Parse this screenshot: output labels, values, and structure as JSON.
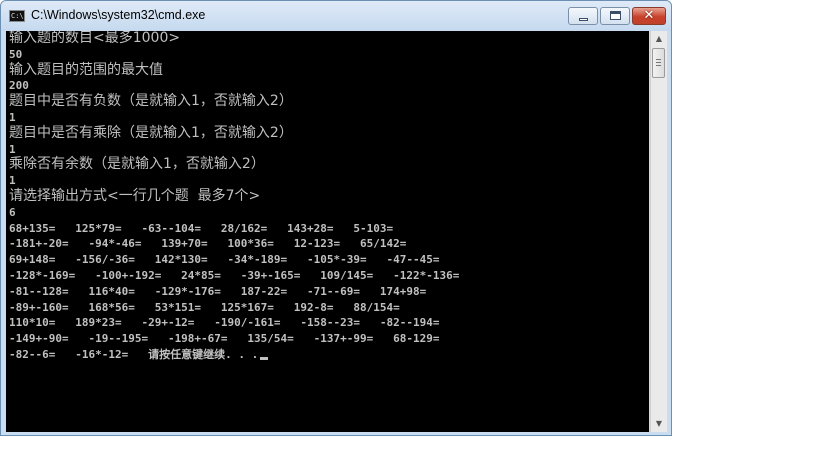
{
  "window": {
    "title": "C:\\Windows\\system32\\cmd.exe",
    "icon": "cmd-icon",
    "icon_label": "C:\\",
    "controls": {
      "minimize": "minimize-icon",
      "maximize": "maximize-icon",
      "close": "close-icon",
      "close_glyph": "✕"
    }
  },
  "colors": {
    "console_bg": "#000000",
    "console_text": "#c0c0c0",
    "close_button": "#c8412b"
  },
  "console": {
    "lines": [
      "输入题的数目<最多1000>",
      "50",
      "输入题目的范围的最大值",
      "200",
      "题目中是否有负数（是就输入1，否就输入2）",
      "1",
      "题目中是否有乘除（是就输入1，否就输入2）",
      "1",
      "乘除否有余数（是就输入1，否就输入2）",
      "1",
      "请选择输出方式<一行几个题  最多7个>",
      "6",
      "68+135=   125*79=   -63--104=   28/162=   143+28=   5-103=",
      "-181+-20=   -94*-46=   139+70=   100*36=   12-123=   65/142=",
      "69+148=   -156/-36=   142*130=   -34*-189=   -105*-39=   -47--45=",
      "-128*-169=   -100+-192=   24*85=   -39+-165=   109/145=   -122*-136=",
      "-81--128=   116*40=   -129*-176=   187-22=   -71--69=   174+98=",
      "-89+-160=   168*56=   53*151=   125*167=   192-8=   88/154=",
      "110*10=   189*23=   -29+-12=   -190/-161=   -158--23=   -82--194=",
      "-149+-90=   -19--195=   -198+-67=   135/54=   -137+-99=   68-129=",
      "-82--6=   -16*-12=   请按任意键继续. . ."
    ]
  },
  "scrollbar": {
    "up_icon": "scroll-up-arrow-icon",
    "down_icon": "scroll-down-arrow-icon",
    "up_glyph": "▲",
    "down_glyph": "▼"
  }
}
